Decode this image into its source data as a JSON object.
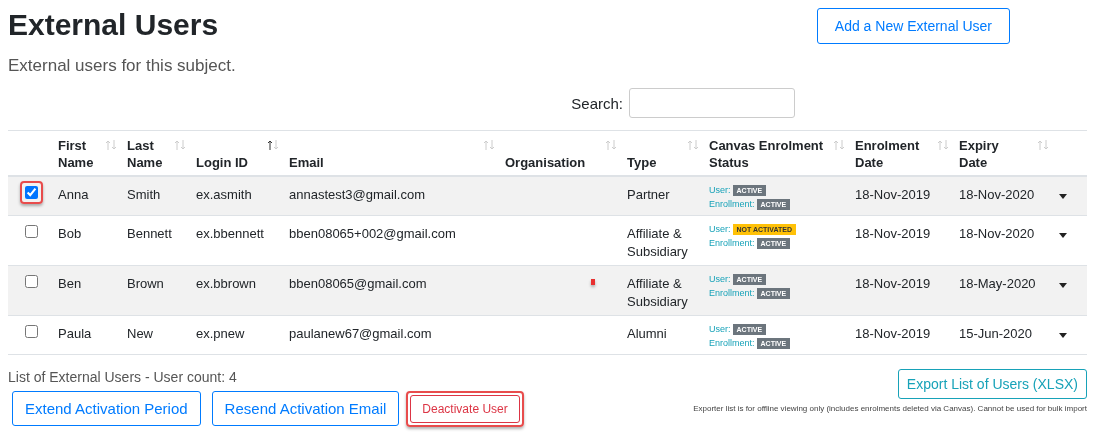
{
  "header": {
    "title": "External Users",
    "subtitle": "External users for this subject.",
    "add_button": "Add a New External User"
  },
  "search": {
    "label": "Search:"
  },
  "table": {
    "columns": [
      {
        "label": "First Name",
        "sorted_ascending": false
      },
      {
        "label": "Last Name",
        "sorted_ascending": false
      },
      {
        "label": "Login ID",
        "sorted_ascending": true
      },
      {
        "label": "Email",
        "sorted_ascending": false
      },
      {
        "label": "Organisation",
        "sorted_ascending": false
      },
      {
        "label": "Type",
        "sorted_ascending": false
      },
      {
        "label": "Canvas Enrolment Status",
        "sorted_ascending": false
      },
      {
        "label": "Enrolment Date",
        "sorted_ascending": false
      },
      {
        "label": "Expiry Date",
        "sorted_ascending": false
      }
    ],
    "rows": [
      {
        "checked": true,
        "highlighted": true,
        "flagged": false,
        "first_name": "Anna",
        "last_name": "Smith",
        "login_id": "ex.asmith",
        "email": "annastest3@gmail.com",
        "type": "Partner",
        "user_label": "User:",
        "user_status": {
          "text": "ACTIVE",
          "kind": "active"
        },
        "enrollment_label": "Enrollment:",
        "enrollment_status": {
          "text": "ACTIVE",
          "kind": "active"
        },
        "enrolment_date": "18-Nov-2019",
        "expiry_date": "18-Nov-2020"
      },
      {
        "checked": false,
        "highlighted": false,
        "flagged": false,
        "first_name": "Bob",
        "last_name": "Bennett",
        "login_id": "ex.bbennett",
        "email": "bben08065+002@gmail.com",
        "type": "Affiliate & Subsidiary",
        "user_label": "User:",
        "user_status": {
          "text": "NOT ACTIVATED",
          "kind": "warning"
        },
        "enrollment_label": "Enrollment:",
        "enrollment_status": {
          "text": "ACTIVE",
          "kind": "active"
        },
        "enrolment_date": "18-Nov-2019",
        "expiry_date": "18-Nov-2020"
      },
      {
        "checked": false,
        "highlighted": false,
        "flagged": true,
        "first_name": "Ben",
        "last_name": "Brown",
        "login_id": "ex.bbrown",
        "email": "bben08065@gmail.com",
        "type": "Affiliate & Subsidiary",
        "user_label": "User:",
        "user_status": {
          "text": "ACTIVE",
          "kind": "active"
        },
        "enrollment_label": "Enrollment:",
        "enrollment_status": {
          "text": "ACTIVE",
          "kind": "active"
        },
        "enrolment_date": "18-Nov-2019",
        "expiry_date": "18-May-2020"
      },
      {
        "checked": false,
        "highlighted": false,
        "flagged": false,
        "first_name": "Paula",
        "last_name": "New",
        "login_id": "ex.pnew",
        "email": "paulanew67@gmail.com",
        "type": "Alumni",
        "user_label": "User:",
        "user_status": {
          "text": "ACTIVE",
          "kind": "active"
        },
        "enrollment_label": "Enrollment:",
        "enrollment_status": {
          "text": "ACTIVE",
          "kind": "active"
        },
        "enrolment_date": "18-Nov-2019",
        "expiry_date": "15-Jun-2020"
      }
    ]
  },
  "footer": {
    "count": "List of External Users - User count: 4",
    "actions": [
      {
        "label": "Extend Activation Period",
        "kind": "primary",
        "highlighted": false
      },
      {
        "label": "Resend Activation Email",
        "kind": "primary",
        "highlighted": false
      },
      {
        "label": "Deactivate User",
        "kind": "danger",
        "highlighted": true
      }
    ],
    "export_button": "Export List of Users (XLSX)",
    "export_note": "Exporter list is for offline viewing only (includes enrolments deleted via Canvas). Cannot be used for bulk import"
  }
}
